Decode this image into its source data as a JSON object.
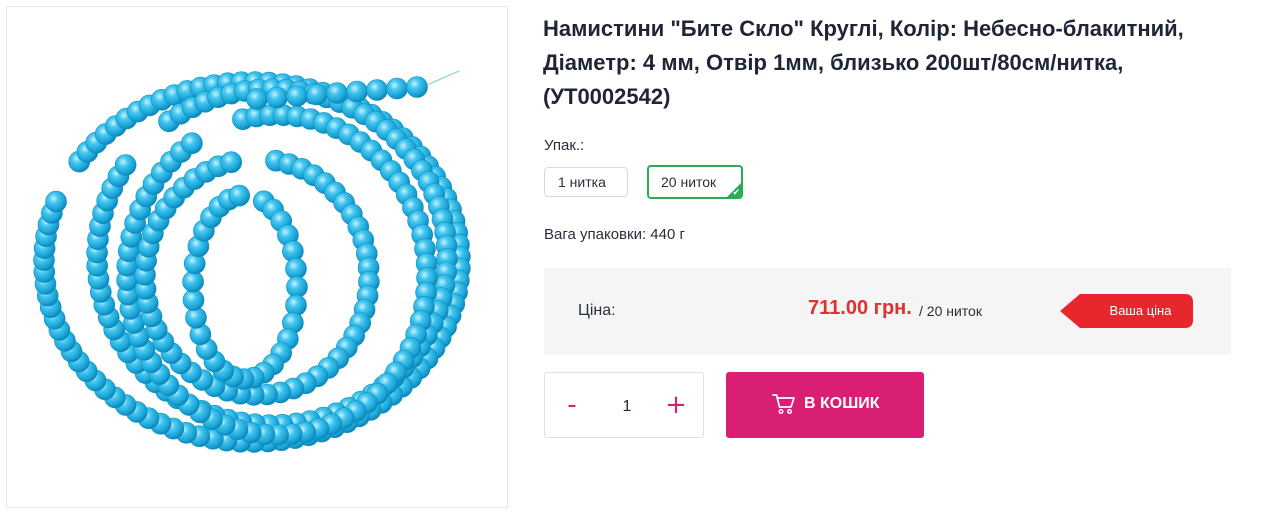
{
  "product": {
    "title": "Намистини \"Бите Скло\" Круглі, Колір: Небесно-блакитний, Діаметр: 4 мм, Отвір 1мм, близько 200шт/80см/нитка, (УТ0002542)",
    "image_icon": "glass-beads-strand-image"
  },
  "packaging": {
    "label": "Упак.:",
    "options": [
      {
        "label": "1 нитка",
        "selected": false
      },
      {
        "label": "20 ниток",
        "selected": true
      }
    ]
  },
  "weight": {
    "text": "Вага упаковки: 440 г"
  },
  "price": {
    "label": "Ціна:",
    "value": "711.00 грн.",
    "unit": "/ 20 ниток",
    "badge": "Ваша ціна"
  },
  "quantity": {
    "minus": "-",
    "value": "1",
    "plus": "+"
  },
  "cart": {
    "label": "В КОШИК",
    "icon": "cart-icon"
  },
  "colors": {
    "accent": "#d81f74",
    "price": "#e03030",
    "selected_border": "#2bab53",
    "bead": "#29b6e6"
  }
}
